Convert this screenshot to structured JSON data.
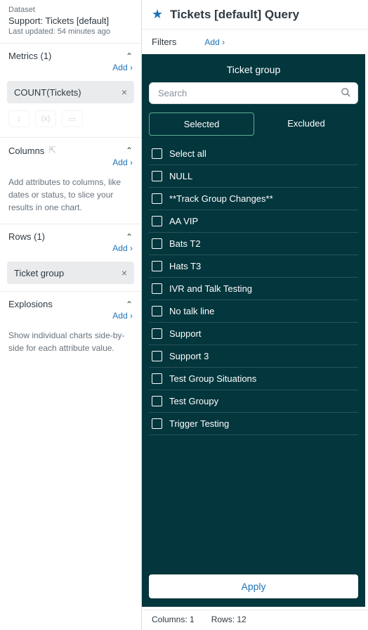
{
  "dataset": {
    "label": "Dataset",
    "name": "Support: Tickets [default]",
    "updated": "Last updated: 54 minutes ago"
  },
  "sidebar": {
    "metrics": {
      "title": "Metrics (1)",
      "add": "Add",
      "chip": "COUNT(Tickets)"
    },
    "columns": {
      "title": "Columns",
      "add": "Add",
      "hint": "Add attributes to columns, like dates or status, to slice your results in one chart."
    },
    "rows": {
      "title": "Rows (1)",
      "add": "Add",
      "chip": "Ticket group"
    },
    "explosions": {
      "title": "Explosions",
      "add": "Add",
      "hint": "Show individual charts side-by-side for each attribute value."
    }
  },
  "header": {
    "title": "Tickets [default] Query"
  },
  "filters": {
    "label": "Filters",
    "add": "Add"
  },
  "panel": {
    "title": "Ticket group",
    "search_placeholder": "Search",
    "tab_selected": "Selected",
    "tab_excluded": "Excluded",
    "items": [
      "Select all",
      "NULL",
      "**Track Group Changes**",
      "AA VIP",
      "Bats T2",
      "Hats T3",
      "IVR and Talk Testing",
      "No talk line",
      "Support",
      "Support 3",
      "Test Group Situations",
      "Test Groupy",
      "Trigger Testing"
    ],
    "apply": "Apply"
  },
  "footer": {
    "columns": "Columns: 1",
    "rows": "Rows: 12"
  }
}
